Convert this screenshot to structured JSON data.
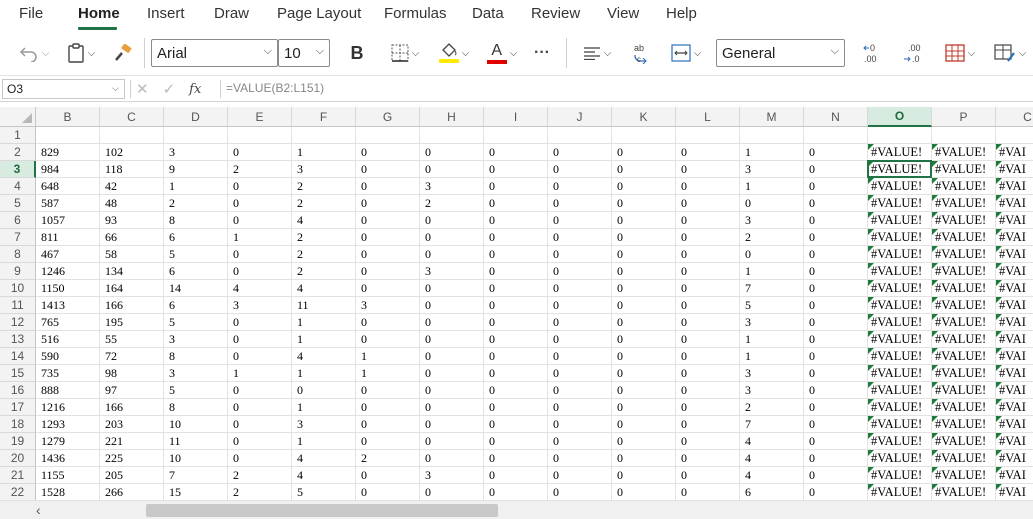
{
  "menu": {
    "items": [
      "File",
      "Home",
      "Insert",
      "Draw",
      "Page Layout",
      "Formulas",
      "Data",
      "Review",
      "View",
      "Help"
    ],
    "active": "Home"
  },
  "ribbon": {
    "font_name": "Arial",
    "font_size": "10",
    "bold_label": "B",
    "font_color_label": "A",
    "more_label": "···",
    "number_format": "General",
    "highlight_color": "#ffeb00",
    "font_color": "#e00000"
  },
  "formula_bar": {
    "name_box": "O3",
    "fx_label": "fx",
    "formula": "=VALUE(B2:L151)"
  },
  "grid": {
    "columns": [
      "B",
      "C",
      "D",
      "E",
      "F",
      "G",
      "H",
      "I",
      "J",
      "K",
      "L",
      "M",
      "N",
      "O",
      "P",
      "C"
    ],
    "selected_column": "O",
    "selected_row": "3",
    "error_text": "#VALUE!",
    "error_text_partial": "#VAI",
    "rows": [
      {
        "num": "1",
        "vals": [
          "",
          "",
          "",
          "",
          "",
          "",
          "",
          "",
          "",
          "",
          "",
          "",
          ""
        ]
      },
      {
        "num": "2",
        "vals": [
          "829",
          "102",
          "3",
          "0",
          "1",
          "0",
          "0",
          "0",
          "0",
          "0",
          "0",
          "1",
          "0"
        ]
      },
      {
        "num": "3",
        "vals": [
          "984",
          "118",
          "9",
          "2",
          "3",
          "0",
          "0",
          "0",
          "0",
          "0",
          "0",
          "3",
          "0"
        ]
      },
      {
        "num": "4",
        "vals": [
          "648",
          "42",
          "1",
          "0",
          "2",
          "0",
          "3",
          "0",
          "0",
          "0",
          "0",
          "1",
          "0"
        ]
      },
      {
        "num": "5",
        "vals": [
          "587",
          "48",
          "2",
          "0",
          "2",
          "0",
          "2",
          "0",
          "0",
          "0",
          "0",
          "0",
          "0"
        ]
      },
      {
        "num": "6",
        "vals": [
          "1057",
          "93",
          "8",
          "0",
          "4",
          "0",
          "0",
          "0",
          "0",
          "0",
          "0",
          "3",
          "0"
        ]
      },
      {
        "num": "7",
        "vals": [
          "811",
          "66",
          "6",
          "1",
          "2",
          "0",
          "0",
          "0",
          "0",
          "0",
          "0",
          "2",
          "0"
        ]
      },
      {
        "num": "8",
        "vals": [
          "467",
          "58",
          "5",
          "0",
          "2",
          "0",
          "0",
          "0",
          "0",
          "0",
          "0",
          "0",
          "0"
        ]
      },
      {
        "num": "9",
        "vals": [
          "1246",
          "134",
          "6",
          "0",
          "2",
          "0",
          "3",
          "0",
          "0",
          "0",
          "0",
          "1",
          "0"
        ]
      },
      {
        "num": "10",
        "vals": [
          "1150",
          "164",
          "14",
          "4",
          "4",
          "0",
          "0",
          "0",
          "0",
          "0",
          "0",
          "7",
          "0"
        ]
      },
      {
        "num": "11",
        "vals": [
          "1413",
          "166",
          "6",
          "3",
          "11",
          "3",
          "0",
          "0",
          "0",
          "0",
          "0",
          "5",
          "0"
        ]
      },
      {
        "num": "12",
        "vals": [
          "765",
          "195",
          "5",
          "0",
          "1",
          "0",
          "0",
          "0",
          "0",
          "0",
          "0",
          "3",
          "0"
        ]
      },
      {
        "num": "13",
        "vals": [
          "516",
          "55",
          "3",
          "0",
          "1",
          "0",
          "0",
          "0",
          "0",
          "0",
          "0",
          "1",
          "0"
        ]
      },
      {
        "num": "14",
        "vals": [
          "590",
          "72",
          "8",
          "0",
          "4",
          "1",
          "0",
          "0",
          "0",
          "0",
          "0",
          "1",
          "0"
        ]
      },
      {
        "num": "15",
        "vals": [
          "735",
          "98",
          "3",
          "1",
          "1",
          "1",
          "0",
          "0",
          "0",
          "0",
          "0",
          "3",
          "0"
        ]
      },
      {
        "num": "16",
        "vals": [
          "888",
          "97",
          "5",
          "0",
          "0",
          "0",
          "0",
          "0",
          "0",
          "0",
          "0",
          "3",
          "0"
        ]
      },
      {
        "num": "17",
        "vals": [
          "1216",
          "166",
          "8",
          "0",
          "1",
          "0",
          "0",
          "0",
          "0",
          "0",
          "0",
          "2",
          "0"
        ]
      },
      {
        "num": "18",
        "vals": [
          "1293",
          "203",
          "10",
          "0",
          "3",
          "0",
          "0",
          "0",
          "0",
          "0",
          "0",
          "7",
          "0"
        ]
      },
      {
        "num": "19",
        "vals": [
          "1279",
          "221",
          "11",
          "0",
          "1",
          "0",
          "0",
          "0",
          "0",
          "0",
          "0",
          "4",
          "0"
        ]
      },
      {
        "num": "20",
        "vals": [
          "1436",
          "225",
          "10",
          "0",
          "4",
          "2",
          "0",
          "0",
          "0",
          "0",
          "0",
          "4",
          "0"
        ]
      },
      {
        "num": "21",
        "vals": [
          "1155",
          "205",
          "7",
          "2",
          "4",
          "0",
          "3",
          "0",
          "0",
          "0",
          "0",
          "4",
          "0"
        ]
      },
      {
        "num": "22",
        "vals": [
          "1528",
          "266",
          "15",
          "2",
          "5",
          "0",
          "0",
          "0",
          "0",
          "0",
          "0",
          "6",
          "0"
        ]
      }
    ]
  }
}
